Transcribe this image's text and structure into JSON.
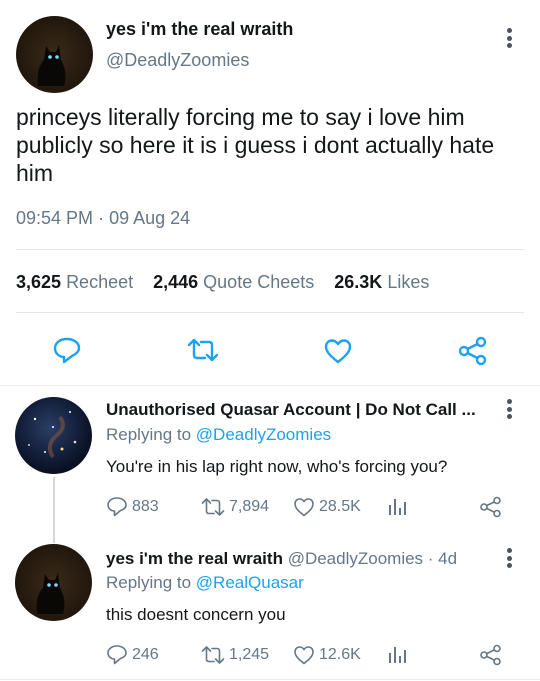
{
  "tweet": {
    "author_name": "yes i'm the real wraith",
    "author_handle": "@DeadlyZoomies",
    "text": "princeys literally forcing me to say i love him publicly so here it is i guess i dont actually hate him",
    "time": "09:54 PM",
    "date_separator": "·",
    "date": "09 Aug 24",
    "stats": [
      {
        "value": "3,625",
        "label": "Recheet"
      },
      {
        "value": "2,446",
        "label": "Quote Cheets"
      },
      {
        "value": "26.3K",
        "label": "Likes"
      }
    ],
    "actions": [
      "reply-icon",
      "retweet-icon",
      "heart-icon",
      "share-icon"
    ]
  },
  "replies": [
    {
      "author_name": "Unauthorised Quasar Account | Do Not Call ...",
      "handle": "",
      "replying_prefix": "Replying to",
      "replying_to": "@DeadlyZoomies",
      "text": "You're in his lap right now, who's forcing you?",
      "counts": {
        "replies": "883",
        "retweets": "7,894",
        "likes": "28.5K"
      }
    },
    {
      "author_name": "yes i'm the real wraith",
      "handle": "@DeadlyZoomies · 4d",
      "replying_prefix": "Replying to",
      "replying_to": "@RealQuasar",
      "text": "this doesnt concern you",
      "counts": {
        "replies": "246",
        "retweets": "1,245",
        "likes": "12.6K"
      }
    }
  ],
  "colors": {
    "link": "#1da1f2",
    "muted": "#657786",
    "text": "#14171a",
    "divider": "#e1e8ed"
  }
}
